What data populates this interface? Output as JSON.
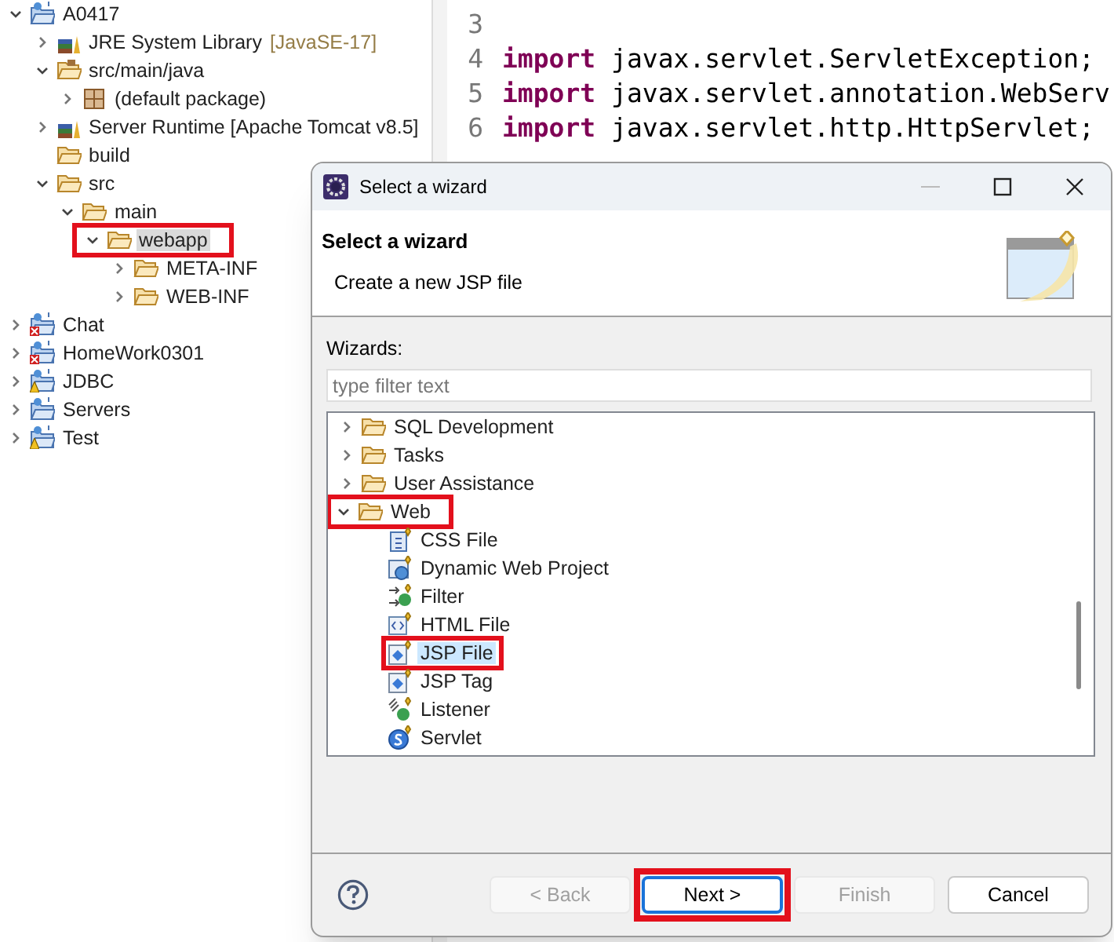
{
  "explorer": {
    "tree": [
      {
        "label": "A0417",
        "kind": "project",
        "error": false,
        "warning": false,
        "expanded": true,
        "selected": false,
        "children": [
          {
            "label": "JRE System Library",
            "suffix": "[JavaSE-17]",
            "kind": "library",
            "expanded": false,
            "selected": false
          },
          {
            "label": "src/main/java",
            "kind": "source-folder",
            "expanded": true,
            "selected": false,
            "children": [
              {
                "label": "(default package)",
                "kind": "package",
                "expanded": false,
                "selected": false
              }
            ]
          },
          {
            "label": "Server Runtime [Apache Tomcat v8.5]",
            "kind": "library",
            "expanded": false,
            "selected": false
          },
          {
            "label": "build",
            "kind": "folder",
            "selected": false
          },
          {
            "label": "src",
            "kind": "folder",
            "expanded": true,
            "selected": false,
            "children": [
              {
                "label": "main",
                "kind": "folder",
                "expanded": true,
                "selected": false,
                "children": [
                  {
                    "label": "webapp",
                    "kind": "folder",
                    "expanded": true,
                    "selected": true,
                    "highlighted": true,
                    "children": [
                      {
                        "label": "META-INF",
                        "kind": "folder",
                        "expanded": false,
                        "selected": false
                      },
                      {
                        "label": "WEB-INF",
                        "kind": "folder",
                        "expanded": false,
                        "selected": false
                      }
                    ]
                  }
                ]
              }
            ]
          }
        ]
      },
      {
        "label": "Chat",
        "kind": "project",
        "error": true,
        "warning": false,
        "expanded": false,
        "selected": false
      },
      {
        "label": "HomeWork0301",
        "kind": "project",
        "error": true,
        "warning": false,
        "expanded": false,
        "selected": false
      },
      {
        "label": "JDBC",
        "kind": "project",
        "error": false,
        "warning": true,
        "expanded": false,
        "selected": false
      },
      {
        "label": "Servers",
        "kind": "project",
        "error": false,
        "warning": false,
        "expanded": false,
        "selected": false
      },
      {
        "label": "Test",
        "kind": "project",
        "error": false,
        "warning": true,
        "expanded": false,
        "selected": false
      }
    ]
  },
  "editor": {
    "lines": [
      {
        "number": "3"
      },
      {
        "number": "4",
        "keyword": "import",
        "code": "javax.servlet.ServletException;"
      },
      {
        "number": "5",
        "keyword": "import",
        "code": "javax.servlet.annotation.WebServ"
      },
      {
        "number": "6",
        "keyword": "import",
        "code": "javax.servlet.http.HttpServlet;"
      }
    ]
  },
  "dialog": {
    "title": "Select a wizard",
    "header": {
      "title": "Select a wizard",
      "description": "Create a new JSP file"
    },
    "wizards_label": "Wizards:",
    "filter": {
      "placeholder": "type filter text"
    },
    "wizards": [
      {
        "label": "SQL Development",
        "kind": "folder",
        "expanded": false,
        "selected": false
      },
      {
        "label": "Tasks",
        "kind": "folder",
        "expanded": false,
        "selected": false
      },
      {
        "label": "User Assistance",
        "kind": "folder",
        "expanded": false,
        "selected": false
      },
      {
        "label": "Web",
        "kind": "folder",
        "expanded": true,
        "selected": false,
        "highlighted": true,
        "children": [
          {
            "label": "CSS File",
            "kind": "css",
            "selected": false
          },
          {
            "label": "Dynamic Web Project",
            "kind": "web-project",
            "selected": false
          },
          {
            "label": "Filter",
            "kind": "filter",
            "selected": false
          },
          {
            "label": "HTML File",
            "kind": "html",
            "selected": false
          },
          {
            "label": "JSP File",
            "kind": "jsp",
            "selected": true,
            "highlighted": true
          },
          {
            "label": "JSP Tag",
            "kind": "jsp",
            "selected": false
          },
          {
            "label": "Listener",
            "kind": "listener",
            "selected": false
          },
          {
            "label": "Servlet",
            "kind": "servlet",
            "selected": false
          }
        ]
      }
    ],
    "buttons": [
      {
        "label": "< Back",
        "disabled": true,
        "focused": false
      },
      {
        "label": "Next >",
        "disabled": false,
        "focused": true,
        "highlighted": true
      },
      {
        "label": "Finish",
        "disabled": true,
        "focused": false
      },
      {
        "label": "Cancel",
        "disabled": false,
        "focused": false
      }
    ]
  }
}
